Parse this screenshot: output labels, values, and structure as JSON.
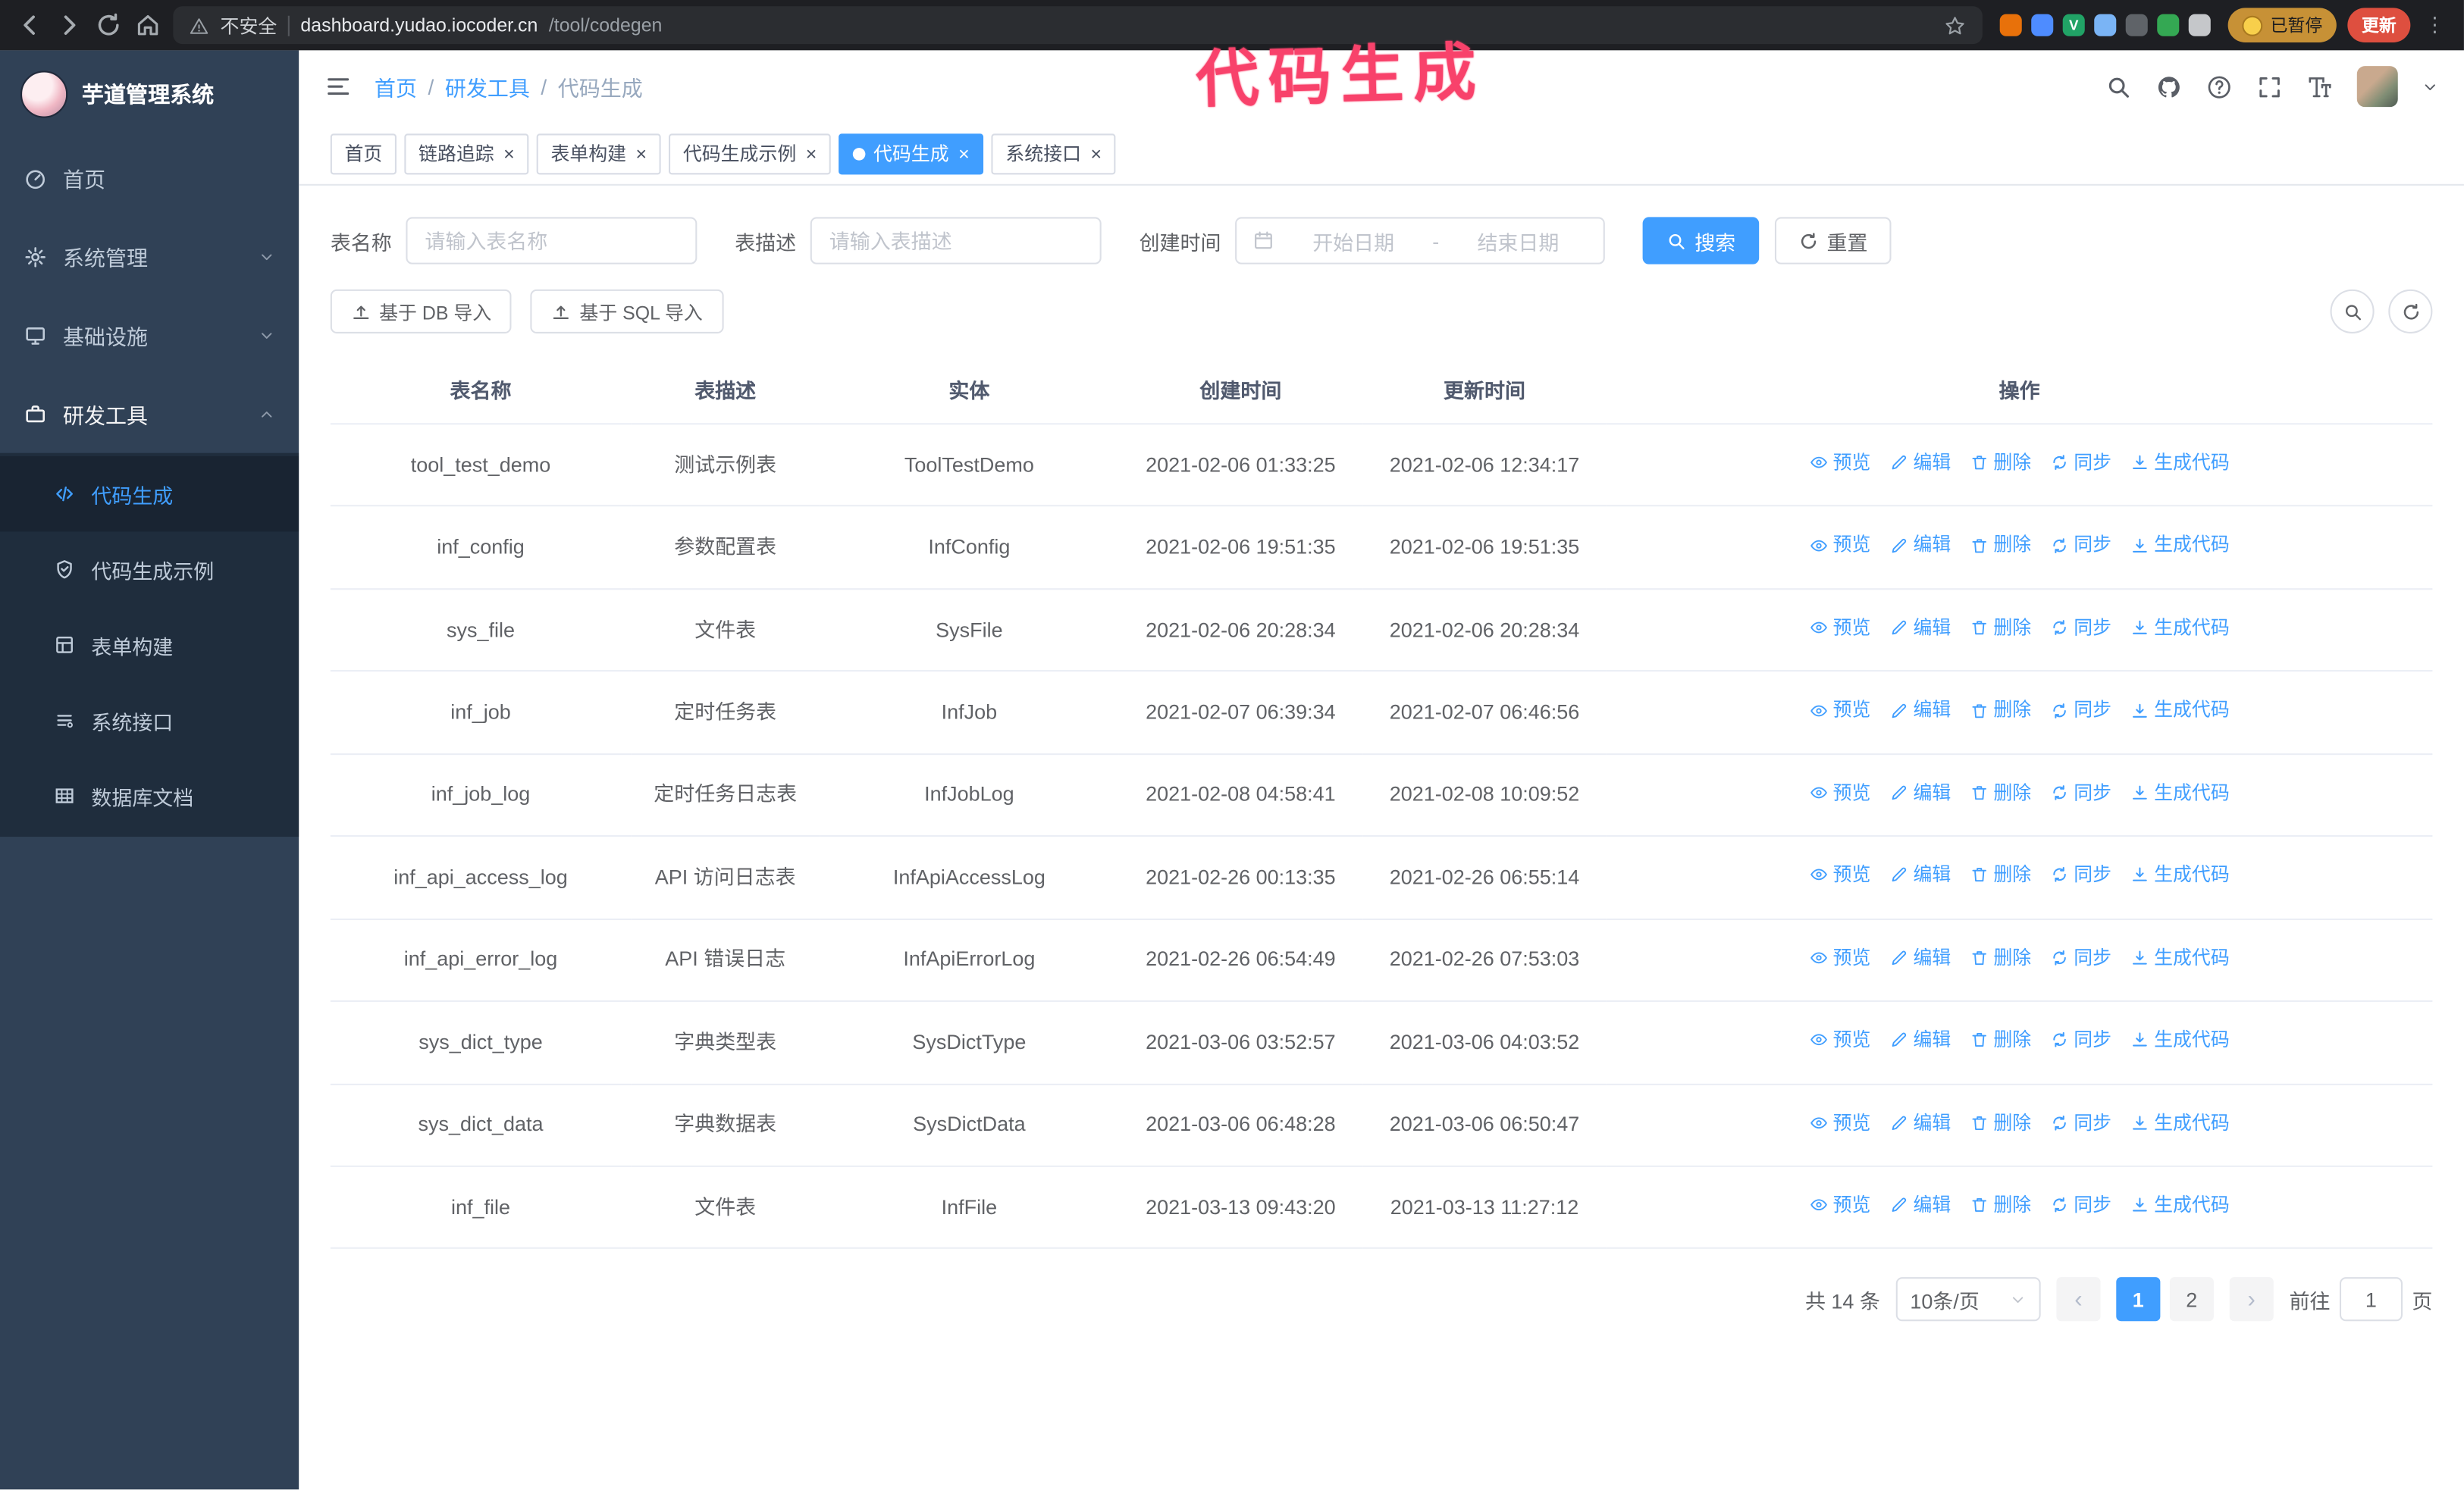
{
  "colors": {
    "accent": "#409eff",
    "sidebar_bg": "#304156",
    "submenu_bg": "#1f2d3d",
    "chrome_bg": "#1e1f23",
    "annotation_pink": "#f8426b",
    "paused_badge_bg": "#c79136",
    "update_button_bg": "#de4f3f"
  },
  "browser": {
    "security_warning": "不安全",
    "url_host": "dashboard.yudao.iocoder.cn",
    "url_path": "/tool/codegen",
    "paused_badge": "已暂停",
    "update_button": "更新",
    "extensions": [
      {
        "name": "fox-extension-icon",
        "color": "#e8710a"
      },
      {
        "name": "blue-extension-icon",
        "color": "#4e8cff"
      },
      {
        "name": "green-v-extension-icon",
        "color": "#21a366",
        "label": "V"
      },
      {
        "name": "people-extension-icon",
        "color": "#7ab4f5"
      },
      {
        "name": "dark-extension-icon",
        "color": "#5f6368"
      },
      {
        "name": "leaf-extension-icon",
        "color": "#34a853"
      },
      {
        "name": "puzzle-extension-icon",
        "color": "#c5c7ca"
      }
    ]
  },
  "annotation": {
    "text": "代码生成",
    "color": "#f8426b"
  },
  "app": {
    "title": "芋道管理系统"
  },
  "sidebar": {
    "items": [
      {
        "label": "首页",
        "icon": "home-icon",
        "expandable": false
      },
      {
        "label": "系统管理",
        "icon": "gear-icon",
        "expandable": true
      },
      {
        "label": "基础设施",
        "icon": "infra-icon",
        "expandable": true
      },
      {
        "label": "研发工具",
        "icon": "tools-icon",
        "expandable": true,
        "expanded": true,
        "children": [
          {
            "label": "代码生成",
            "icon": "code-icon",
            "active": true
          },
          {
            "label": "代码生成示例",
            "icon": "example-icon"
          },
          {
            "label": "表单构建",
            "icon": "form-icon"
          },
          {
            "label": "系统接口",
            "icon": "api-icon"
          },
          {
            "label": "数据库文档",
            "icon": "database-icon"
          }
        ]
      }
    ]
  },
  "breadcrumb": [
    "首页",
    "研发工具",
    "代码生成"
  ],
  "tabs": [
    {
      "label": "首页",
      "closable": false,
      "active": false
    },
    {
      "label": "链路追踪",
      "closable": true,
      "active": false
    },
    {
      "label": "表单构建",
      "closable": true,
      "active": false
    },
    {
      "label": "代码生成示例",
      "closable": true,
      "active": false
    },
    {
      "label": "代码生成",
      "closable": true,
      "active": true
    },
    {
      "label": "系统接口",
      "closable": true,
      "active": false
    }
  ],
  "filters": {
    "table_name_label": "表名称",
    "table_name_placeholder": "请输入表名称",
    "table_desc_label": "表描述",
    "table_desc_placeholder": "请输入表描述",
    "create_time_label": "创建时间",
    "date_start_placeholder": "开始日期",
    "date_separator": "-",
    "date_end_placeholder": "结束日期",
    "search_button": "搜索",
    "reset_button": "重置"
  },
  "toolbar": {
    "import_db": "基于 DB 导入",
    "import_sql": "基于 SQL 导入"
  },
  "table": {
    "columns": [
      "表名称",
      "表描述",
      "实体",
      "创建时间",
      "更新时间",
      "操作"
    ],
    "row_actions": [
      {
        "label": "预览",
        "name": "preview-action",
        "icon": "eye-icon"
      },
      {
        "label": "编辑",
        "name": "edit-action",
        "icon": "edit-icon"
      },
      {
        "label": "删除",
        "name": "delete-action",
        "icon": "delete-icon"
      },
      {
        "label": "同步",
        "name": "sync-action",
        "icon": "sync-icon"
      },
      {
        "label": "生成代码",
        "name": "generate-code-action",
        "icon": "gencode-icon"
      }
    ],
    "rows": [
      {
        "name": "tool_test_demo",
        "desc": "测试示例表",
        "entity": "ToolTestDemo",
        "created": "2021-02-06 01:33:25",
        "updated": "2021-02-06 12:34:17"
      },
      {
        "name": "inf_config",
        "desc": "参数配置表",
        "entity": "InfConfig",
        "created": "2021-02-06 19:51:35",
        "updated": "2021-02-06 19:51:35"
      },
      {
        "name": "sys_file",
        "desc": "文件表",
        "entity": "SysFile",
        "created": "2021-02-06 20:28:34",
        "updated": "2021-02-06 20:28:34"
      },
      {
        "name": "inf_job",
        "desc": "定时任务表",
        "entity": "InfJob",
        "created": "2021-02-07 06:39:34",
        "updated": "2021-02-07 06:46:56"
      },
      {
        "name": "inf_job_log",
        "desc": "定时任务日志表",
        "entity": "InfJobLog",
        "created": "2021-02-08 04:58:41",
        "updated": "2021-02-08 10:09:52"
      },
      {
        "name": "inf_api_access_log",
        "desc": "API 访问日志表",
        "entity": "InfApiAccessLog",
        "created": "2021-02-26 00:13:35",
        "updated": "2021-02-26 06:55:14"
      },
      {
        "name": "inf_api_error_log",
        "desc": "API 错误日志",
        "entity": "InfApiErrorLog",
        "created": "2021-02-26 06:54:49",
        "updated": "2021-02-26 07:53:03"
      },
      {
        "name": "sys_dict_type",
        "desc": "字典类型表",
        "entity": "SysDictType",
        "created": "2021-03-06 03:52:57",
        "updated": "2021-03-06 04:03:52"
      },
      {
        "name": "sys_dict_data",
        "desc": "字典数据表",
        "entity": "SysDictData",
        "created": "2021-03-06 06:48:28",
        "updated": "2021-03-06 06:50:47"
      },
      {
        "name": "inf_file",
        "desc": "文件表",
        "entity": "InfFile",
        "created": "2021-03-13 09:43:20",
        "updated": "2021-03-13 11:27:12"
      }
    ]
  },
  "pagination": {
    "total_text": "共 14 条",
    "page_size": "10条/页",
    "pages": [
      "1",
      "2"
    ],
    "active_page": "1",
    "prev_symbol": "‹",
    "next_symbol": "›",
    "goto_label": "前往",
    "goto_value": "1",
    "goto_suffix": "页"
  }
}
